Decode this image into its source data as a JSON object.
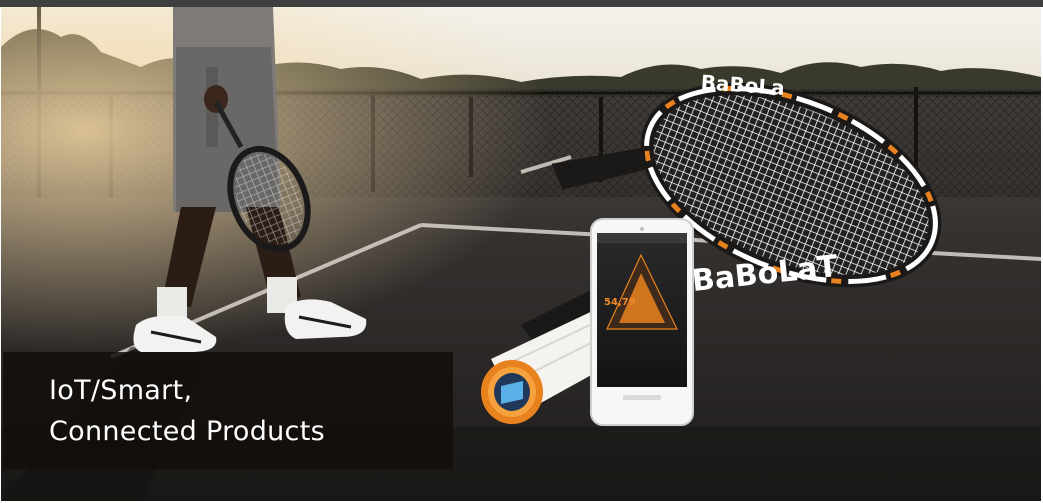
{
  "caption": {
    "line1": "IoT/Smart,",
    "line2": "Connected Products"
  },
  "photo": {
    "racket_brand": "BaBoLaT",
    "phone_reading": "54,79",
    "colors": {
      "accent_orange": "#e8821e",
      "caption_bg": "#120e0c",
      "court": "#2e2c2b",
      "sky": "#f2efe6"
    },
    "icons": [
      "racket-icon",
      "smartphone-icon",
      "sensor-icon"
    ]
  }
}
